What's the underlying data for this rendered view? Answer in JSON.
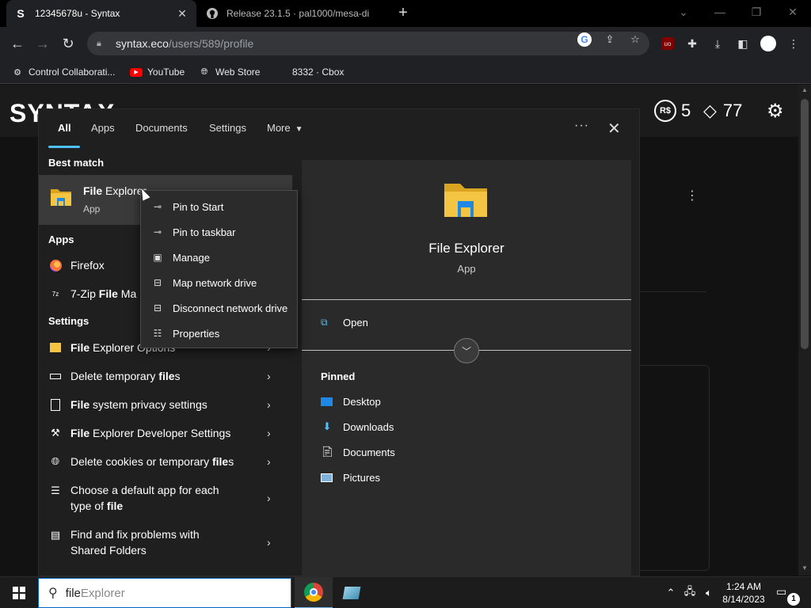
{
  "browser": {
    "tabs": [
      {
        "favicon": "S",
        "title": "12345678u - Syntax",
        "active": true
      },
      {
        "favicon": "github-icon",
        "title": "Release 23.1.5 · pal1000/mesa-di",
        "active": false
      }
    ],
    "new_tab": "+",
    "url_host": "syntax.eco",
    "url_path": "/users/589/profile",
    "bookmarks": [
      {
        "label": "Control Collaborati...",
        "icon": "control-icon"
      },
      {
        "label": "YouTube",
        "icon": "youtube-icon"
      },
      {
        "label": "Web Store",
        "icon": "webstore-icon"
      },
      {
        "label": "8332 · Cbox",
        "icon": ""
      }
    ]
  },
  "site": {
    "logo": "SYNTAX",
    "currency_value": "5",
    "currency_icon": "R$",
    "tickets_value": "77"
  },
  "search_panel": {
    "tabs": [
      "All",
      "Apps",
      "Documents",
      "Settings",
      "More"
    ],
    "best_match_heading": "Best match",
    "best_match": {
      "name_bold": "File",
      "name_rest": " Explorer",
      "type": "App"
    },
    "apps_heading": "Apps",
    "apps": [
      {
        "label": "Firefox"
      },
      {
        "label_pre": "7-Zip ",
        "label_bold": "File",
        "label_post": " Ma"
      }
    ],
    "settings_heading": "Settings",
    "settings": [
      {
        "pre": "",
        "bold": "File",
        "post": " Explorer Options"
      },
      {
        "pre": "Delete temporary ",
        "bold": "file",
        "post": "s"
      },
      {
        "pre": "",
        "bold": "File",
        "post": " system privacy settings"
      },
      {
        "pre": "",
        "bold": "File",
        "post": " Explorer Developer Settings"
      },
      {
        "pre": "Delete cookies or temporary ",
        "bold": "file",
        "post": "s"
      },
      {
        "line1": "Choose a default app for each",
        "line2_pre": "type of ",
        "line2_bold": "file"
      },
      {
        "line1": "Find and fix problems with",
        "line2": "Shared Folders"
      }
    ],
    "detail": {
      "name": "File Explorer",
      "type": "App",
      "open_label": "Open",
      "pinned_heading": "Pinned",
      "pinned": [
        "Desktop",
        "Downloads",
        "Documents",
        "Pictures"
      ]
    },
    "context_menu": [
      "Pin to Start",
      "Pin to taskbar",
      "Manage",
      "Map network drive",
      "Disconnect network drive",
      "Properties"
    ]
  },
  "taskbar": {
    "search_typed": "file",
    "search_hint": " Explorer",
    "time": "1:24 AM",
    "date": "8/14/2023",
    "notification_count": "1"
  },
  "colors": {
    "accent": "#4cc2ff",
    "folder_yellow": "#f4c542",
    "taskbar_accent": "#76b9ed"
  }
}
